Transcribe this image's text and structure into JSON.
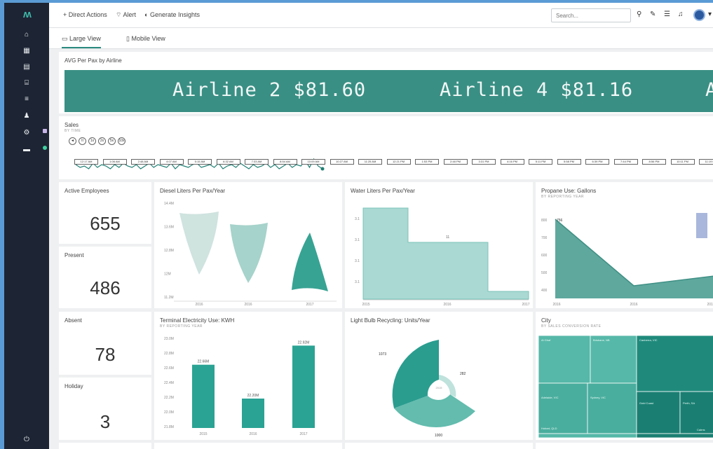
{
  "topbar": {
    "direct_actions": "+ Direct Actions",
    "alert": "Alert",
    "generate_insights": "Generate Insights",
    "search_placeholder": "Search..."
  },
  "views": {
    "large": "Large View",
    "mobile": "Mobile View"
  },
  "ticker": {
    "title": "AVG Per Pax by Airline",
    "items": [
      "Airline 2 $81.60",
      "Airline 4 $81.16",
      "A"
    ],
    "background": "#3a8f84"
  },
  "sales": {
    "title": "Sales",
    "subtitle": "BY TIME",
    "controls": [
      "◄",
      "II",
      "1x",
      "2x",
      "5x",
      "10x"
    ],
    "timeline": [
      "12:17 AM",
      "1:06 AM",
      "2:48 AM",
      "4:07 AM",
      "5:15 AM",
      "6:32 AM",
      "7:33 AM",
      "8:54 AM",
      "10:09 AM",
      "10:27 AM",
      "11:25 AM",
      "12:21 PM",
      "1:53 PM",
      "2:48 PM",
      "3:31 PM",
      "4:16 PM",
      "5:11 PM",
      "5:58 PM",
      "6:39 PM",
      "7:44 PM",
      "8:56 PM",
      "10:11 PM",
      "11:19 PM"
    ],
    "end_label": "1:00",
    "series": [
      5,
      3,
      4,
      2,
      6,
      3,
      5,
      4,
      2,
      5,
      3,
      6,
      4,
      3,
      5,
      2,
      4,
      6,
      3,
      5,
      4,
      3,
      6,
      2,
      5,
      4,
      3,
      5,
      6,
      3,
      4,
      5,
      3,
      6,
      2,
      4,
      5,
      3,
      6,
      4,
      2,
      5,
      3,
      4,
      6,
      3,
      5,
      2,
      4,
      6,
      3,
      5,
      4,
      8,
      3,
      9,
      4,
      2
    ]
  },
  "kpis": {
    "active": {
      "label": "Active Employees",
      "value": "655"
    },
    "present": {
      "label": "Present",
      "value": "486"
    },
    "absent": {
      "label": "Absent",
      "value": "78"
    },
    "holiday": {
      "label": "Holiday",
      "value": "3"
    }
  },
  "diesel": {
    "title": "Diesel Liters Per Pax/Year",
    "yticks": [
      "14.4M",
      "13.6M",
      "12.8M",
      "12M",
      "11.2M"
    ],
    "xticks": [
      "2016",
      "2016",
      "2017"
    ]
  },
  "water": {
    "title": "Water Liters Per Pax/Year",
    "yticks": [
      "3.1",
      "3.1",
      "3.1",
      "3.1"
    ],
    "xticks": [
      "2015",
      "2016",
      "2017"
    ],
    "step_label": "11"
  },
  "propane": {
    "title": "Propane Use: Gallons",
    "subtitle": "BY REPORTING YEAR",
    "yticks": [
      "800",
      "700",
      "600",
      "500",
      "400"
    ],
    "xticks": [
      "2016",
      "2016",
      "2017"
    ],
    "first_label": "756"
  },
  "electricity": {
    "title": "Terminal Electricity Use: KWH",
    "subtitle": "BY REPORTING YEAR",
    "yticks": [
      "23.0M",
      "22.8M",
      "22.6M",
      "22.4M",
      "22.2M",
      "22.0M",
      "21.8M"
    ],
    "xticks": [
      "2015",
      "2016",
      "2017"
    ],
    "chart_data": {
      "type": "bar",
      "categories": [
        "2015",
        "2016",
        "2017"
      ],
      "values": [
        22.66,
        22.2,
        22.92
      ],
      "labels": [
        "22.66M",
        "22.20M",
        "22.92M"
      ],
      "ylim": [
        21.8,
        23.0
      ]
    }
  },
  "lightbulb": {
    "title": "Light Bulb Recycling: Units/Year",
    "chart_data": {
      "type": "pie",
      "labels": [
        "1073",
        "282",
        "1000"
      ],
      "values": [
        1073,
        282,
        1000
      ],
      "center": "2015"
    }
  },
  "city": {
    "title": "City",
    "subtitle": "BY SALES CONVERSION RATE",
    "cells": [
      "Al Ghaf",
      "Brisbane, NB",
      "Adelaide, VIC",
      "Sydney, VIC",
      "Canberra, VIC",
      "Gold Coast",
      "Perth, SA",
      "Hobart, QLD",
      "Cairns"
    ]
  }
}
